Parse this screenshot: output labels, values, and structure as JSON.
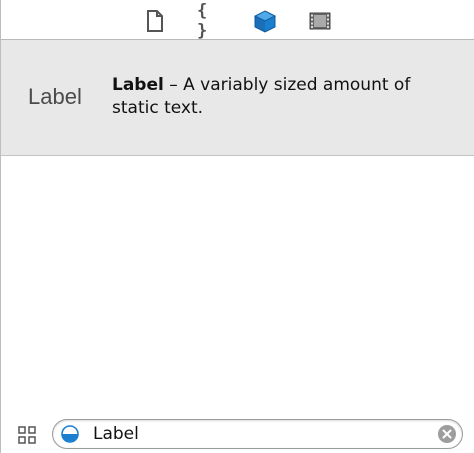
{
  "library_tabs": [
    {
      "icon": "file-template-icon"
    },
    {
      "icon": "code-snippet-icon",
      "glyph": "{ }"
    },
    {
      "icon": "object-library-icon",
      "active": true,
      "color": "#1b7fd0"
    },
    {
      "icon": "media-library-icon"
    }
  ],
  "object": {
    "preview_text": "Label",
    "name": "Label",
    "description": " – A variably sized amount of static text."
  },
  "search": {
    "value": "Label"
  },
  "colors": {
    "row_background": "#e8e8e8",
    "accent": "#1b7fd0"
  }
}
